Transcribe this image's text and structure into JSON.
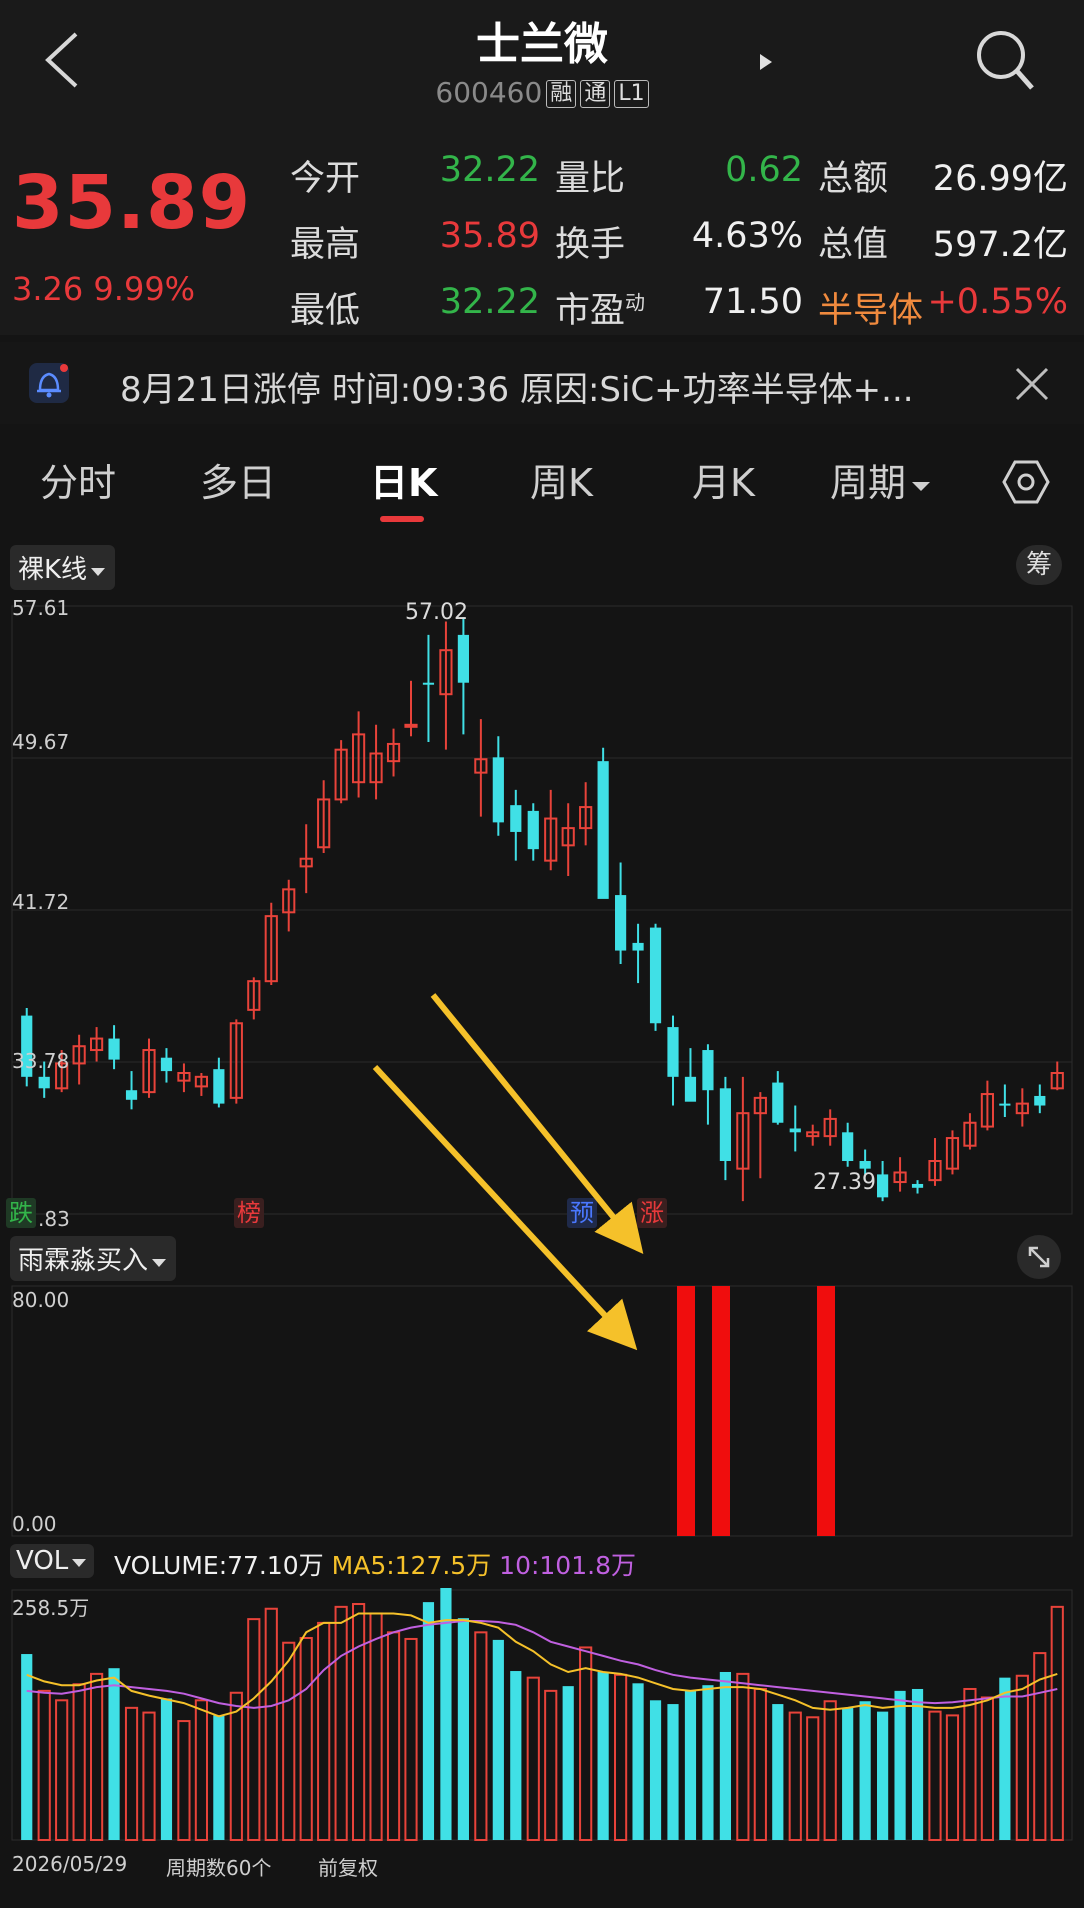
{
  "header": {
    "title": "士兰微",
    "code": "600460",
    "tags": [
      "融",
      "通",
      "L1"
    ]
  },
  "quote": {
    "price": "35.89",
    "change": "3.26",
    "change_pct": "9.99%",
    "fields": [
      {
        "label": "今开",
        "value": "32.22",
        "color": "#33b54a"
      },
      {
        "label": "最高",
        "value": "35.89",
        "color": "#e8393b"
      },
      {
        "label": "最低",
        "value": "32.22",
        "color": "#33b54a"
      },
      {
        "label": "量比",
        "value": "0.62",
        "color": "#33b54a"
      },
      {
        "label": "换手",
        "value": "4.63%",
        "color": "#f0f0f0"
      },
      {
        "label": "市盈",
        "label_sup": "动",
        "value": "71.50",
        "color": "#f0f0f0"
      },
      {
        "label": "总额",
        "value": "26.99亿",
        "color": "#f0f0f0"
      },
      {
        "label": "总值",
        "value": "597.2亿",
        "color": "#f0f0f0"
      },
      {
        "label": "半导体",
        "value": "+0.55%",
        "color": "#e8393b",
        "label_color": "#f08a3e"
      }
    ]
  },
  "notice": {
    "text": "8月21日涨停  时间:09:36  原因:SiC+功率半导体+..."
  },
  "tabs": {
    "items": [
      "分时",
      "多日",
      "日K",
      "周K",
      "月K",
      "周期"
    ],
    "active": "日K"
  },
  "kline": {
    "mode_label": "裸K线",
    "chip_label": "筹",
    "y_ticks": [
      "57.61",
      "49.67",
      "41.72",
      "33.78",
      ".83"
    ],
    "high_label": "57.02",
    "low_label": "27.39",
    "badges": [
      {
        "text": "跌",
        "color": "#33b54a"
      },
      {
        "text": "榜",
        "color": "#e8393b"
      },
      {
        "text": "预",
        "color": "#4a78ff"
      },
      {
        "text": "涨",
        "color": "#e8393b"
      }
    ]
  },
  "indicator": {
    "label": "雨霖淼买入",
    "y_top": "80.00",
    "y_bottom": "0.00",
    "signal_values": [
      80,
      80,
      80
    ]
  },
  "volume": {
    "label": "VOL",
    "volume_text": "VOLUME:77.10万",
    "ma5_text": "MA5:127.5万",
    "ma10_text": "10:101.8万",
    "y_top": "258.5万"
  },
  "footer": {
    "start_date": "2026/05/29",
    "period_count": "周期数60个",
    "adjust": "前复权"
  },
  "chart_data": {
    "type": "candlestick",
    "ylim": [
      25.83,
      57.61
    ],
    "colors": {
      "up": "#e8433a",
      "down": "#40e0e6"
    },
    "ohlc": [
      [
        36.2,
        36.6,
        32.5,
        33.0
      ],
      [
        33.0,
        33.8,
        31.9,
        32.4
      ],
      [
        32.4,
        34.4,
        32.2,
        33.7
      ],
      [
        33.7,
        35.2,
        32.6,
        34.6
      ],
      [
        34.4,
        35.6,
        33.8,
        35.0
      ],
      [
        35.0,
        35.7,
        33.4,
        33.9
      ],
      [
        32.3,
        33.3,
        31.3,
        31.8
      ],
      [
        32.2,
        35.0,
        31.9,
        34.4
      ],
      [
        34.0,
        34.5,
        32.7,
        33.3
      ],
      [
        32.8,
        33.7,
        32.2,
        33.2
      ],
      [
        32.5,
        33.2,
        32.0,
        33.0
      ],
      [
        33.4,
        34.0,
        31.4,
        31.6
      ],
      [
        31.9,
        36.0,
        31.6,
        35.8
      ],
      [
        36.5,
        38.2,
        36.0,
        38.0
      ],
      [
        38.0,
        42.1,
        37.8,
        41.4
      ],
      [
        41.6,
        43.3,
        40.6,
        42.8
      ],
      [
        44.0,
        46.2,
        42.6,
        44.4
      ],
      [
        45.0,
        48.5,
        44.7,
        47.5
      ],
      [
        47.5,
        50.6,
        47.3,
        50.1
      ],
      [
        48.4,
        52.1,
        47.6,
        50.9
      ],
      [
        48.4,
        51.4,
        47.5,
        49.9
      ],
      [
        49.5,
        51.2,
        48.7,
        50.4
      ],
      [
        51.4,
        53.7,
        50.8,
        51.4
      ],
      [
        53.6,
        56.1,
        50.5,
        53.5
      ],
      [
        53.0,
        56.8,
        50.1,
        55.3
      ],
      [
        56.1,
        57.02,
        50.9,
        53.6
      ],
      [
        48.9,
        51.7,
        46.6,
        49.6
      ],
      [
        49.7,
        50.8,
        45.6,
        46.3
      ],
      [
        47.2,
        48.0,
        44.3,
        45.8
      ],
      [
        46.9,
        47.3,
        44.3,
        44.9
      ],
      [
        44.3,
        48.0,
        43.8,
        46.5
      ],
      [
        45.1,
        47.3,
        43.5,
        46.0
      ],
      [
        46.0,
        48.4,
        45.1,
        47.1
      ],
      [
        49.5,
        50.2,
        42.8,
        42.3
      ],
      [
        42.5,
        44.2,
        38.9,
        39.6
      ],
      [
        40.0,
        41.0,
        37.9,
        39.6
      ],
      [
        40.8,
        41.0,
        35.4,
        35.8
      ],
      [
        35.6,
        36.2,
        31.5,
        33.0
      ],
      [
        33.0,
        34.5,
        32.1,
        31.7
      ],
      [
        34.4,
        34.7,
        30.5,
        32.3
      ],
      [
        32.4,
        33.0,
        27.6,
        28.6
      ],
      [
        28.2,
        33.0,
        26.5,
        31.1
      ],
      [
        31.1,
        32.2,
        27.7,
        31.9
      ],
      [
        32.7,
        33.3,
        30.5,
        30.6
      ],
      [
        30.3,
        31.5,
        29.1,
        30.1
      ],
      [
        29.9,
        30.5,
        29.4,
        30.1
      ],
      [
        29.9,
        31.3,
        29.4,
        30.8
      ],
      [
        30.1,
        30.6,
        28.3,
        28.6
      ],
      [
        28.6,
        29.2,
        27.9,
        28.2
      ],
      [
        27.9,
        28.6,
        26.5,
        26.7
      ],
      [
        27.5,
        28.8,
        27.0,
        28.0
      ],
      [
        27.4,
        27.6,
        26.9,
        27.2
      ],
      [
        27.6,
        29.8,
        27.3,
        28.6
      ],
      [
        28.2,
        30.2,
        27.9,
        29.8
      ],
      [
        29.4,
        31.1,
        29.2,
        30.6
      ],
      [
        30.4,
        32.8,
        30.2,
        32.1
      ],
      [
        31.6,
        32.6,
        30.9,
        31.5
      ],
      [
        31.1,
        32.4,
        30.4,
        31.6
      ],
      [
        32.0,
        32.6,
        31.1,
        31.5
      ],
      [
        32.4,
        33.8,
        32.3,
        33.2
      ]
    ],
    "volume": [
      197,
      158,
      148,
      165,
      176,
      182,
      140,
      135,
      150,
      126,
      148,
      132,
      156,
      234,
      245,
      209,
      214,
      230,
      247,
      250,
      240,
      220,
      213,
      252,
      296,
      235,
      220,
      212,
      179,
      172,
      158,
      163,
      204,
      178,
      175,
      166,
      148,
      144,
      158,
      164,
      178,
      176,
      160,
      144,
      135,
      130,
      147,
      140,
      147,
      136,
      158,
      160,
      136,
      132,
      160,
      151,
      172,
      174,
      198,
      247
    ],
    "volume_up": [
      false,
      true,
      true,
      true,
      true,
      false,
      true,
      true,
      false,
      true,
      true,
      false,
      true,
      true,
      true,
      true,
      true,
      true,
      true,
      true,
      true,
      true,
      true,
      false,
      false,
      false,
      true,
      false,
      false,
      true,
      true,
      false,
      true,
      false,
      true,
      false,
      false,
      false,
      false,
      false,
      false,
      true,
      true,
      false,
      true,
      true,
      true,
      false,
      false,
      false,
      false,
      false,
      true,
      true,
      true,
      true,
      false,
      true,
      true,
      true
    ],
    "ma5": [
      175,
      168,
      164,
      164,
      169,
      172,
      158,
      153,
      149,
      145,
      138,
      131,
      136,
      150,
      168,
      190,
      220,
      230,
      230,
      240,
      240,
      240,
      238,
      230,
      233,
      233,
      230,
      225,
      210,
      200,
      186,
      178,
      182,
      178,
      176,
      172,
      166,
      160,
      158,
      160,
      162,
      162,
      160,
      154,
      148,
      140,
      138,
      140,
      143,
      140,
      142,
      142,
      140,
      140,
      143,
      148,
      156,
      160,
      170,
      176
    ],
    "ma10": [
      158,
      156,
      155,
      158,
      162,
      164,
      162,
      160,
      158,
      155,
      150,
      145,
      142,
      140,
      142,
      148,
      160,
      180,
      195,
      205,
      213,
      220,
      225,
      228,
      230,
      232,
      232,
      231,
      228,
      220,
      210,
      205,
      200,
      195,
      190,
      186,
      180,
      175,
      172,
      170,
      168,
      166,
      164,
      162,
      160,
      158,
      156,
      154,
      152,
      150,
      148,
      146,
      145,
      146,
      148,
      150,
      152,
      152,
      156,
      160
    ],
    "volume_ylim": [
      0,
      258.5
    ]
  }
}
